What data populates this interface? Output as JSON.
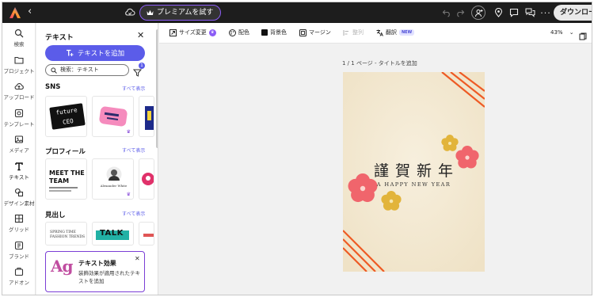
{
  "topbar": {
    "back_icon": "chevron-left-icon",
    "cloud_icon": "cloud-save-icon",
    "premium_label": "プレミアムを試す",
    "download_label": "ダウンロード"
  },
  "rail": {
    "items": [
      {
        "label": "検索",
        "icon": "search-icon"
      },
      {
        "label": "プロジェクト",
        "icon": "folder-icon"
      },
      {
        "label": "アップロード",
        "icon": "upload-icon"
      },
      {
        "label": "テンプレート",
        "icon": "template-icon"
      },
      {
        "label": "メディア",
        "icon": "media-icon"
      },
      {
        "label": "テキスト",
        "icon": "text-icon"
      },
      {
        "label": "デザイン素材",
        "icon": "shapes-icon"
      },
      {
        "label": "グリッド",
        "icon": "grid-icon"
      },
      {
        "label": "ブランド",
        "icon": "brand-icon"
      },
      {
        "label": "アドオン",
        "icon": "addon-icon"
      }
    ]
  },
  "panel": {
    "title": "テキスト",
    "add_text_label": "テキストを追加",
    "search_placeholder": "検索：テキスト",
    "filter_count": "1",
    "sections": [
      {
        "title": "SNS",
        "see_all": "すべて表示"
      },
      {
        "title": "プロフィール",
        "see_all": "すべて表示"
      },
      {
        "title": "見出し",
        "see_all": "すべて表示"
      }
    ],
    "tiles": {
      "sns_1": "future CEO",
      "profile_1_line1": "MEET THE",
      "profile_1_line2": "TEAM",
      "profile_2_name": "Alexander White",
      "heading_1_line1": "SPRING TIME",
      "heading_1_line2": "FASHION TRENDS",
      "heading_2": "TALK"
    },
    "effect_card": {
      "sample": "Ag",
      "title": "テキスト効果",
      "description": "装飾効果が適用されたテキストを追加"
    }
  },
  "toolbar": {
    "resize": "サイズ変更",
    "palette": "配色",
    "background": "背景色",
    "margin": "マージン",
    "align": "整列",
    "translate": "翻訳",
    "new_badge": "NEW",
    "zoom": "43%"
  },
  "canvas": {
    "page_label": "1 / 1 ページ - タイトルを追加",
    "card_title": "謹 賀 新 年",
    "card_subtitle": "A HAPPY NEW YEAR"
  },
  "colors": {
    "accent": "#5b5ce9",
    "premium_border": "#8c5cf5",
    "card_bg": "#f3e9d4",
    "stripe": "#ee5a24",
    "flower_red": "#f0656c",
    "flower_yellow": "#e2b43b"
  }
}
